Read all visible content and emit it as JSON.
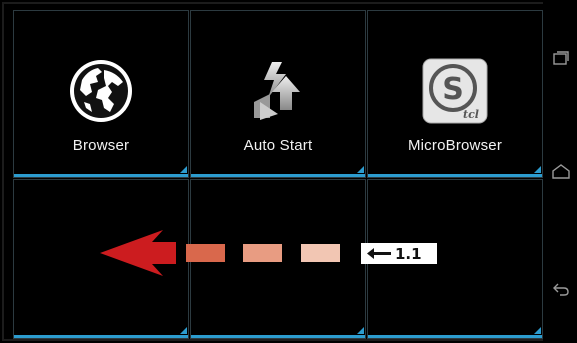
{
  "tiles": [
    {
      "label": "Browser",
      "icon": "globe-icon"
    },
    {
      "label": "Auto Start",
      "icon": "auto-start-icon"
    },
    {
      "label": "MicroBrowser",
      "icon": "microbrowser-icon",
      "badge": "tcl"
    },
    {
      "label": ""
    },
    {
      "label": ""
    },
    {
      "label": ""
    }
  ],
  "annotation": {
    "step": "1.1",
    "direction": "swipe-left",
    "arrow_color": "#cc1c1f",
    "dash_colors": [
      "#d9684c",
      "#e89c82",
      "#f2c6b3"
    ]
  },
  "navbar": {
    "buttons": [
      "recent-apps-icon",
      "home-icon",
      "back-icon"
    ]
  },
  "colors": {
    "accent": "#2c9ccf",
    "background": "#000000"
  }
}
